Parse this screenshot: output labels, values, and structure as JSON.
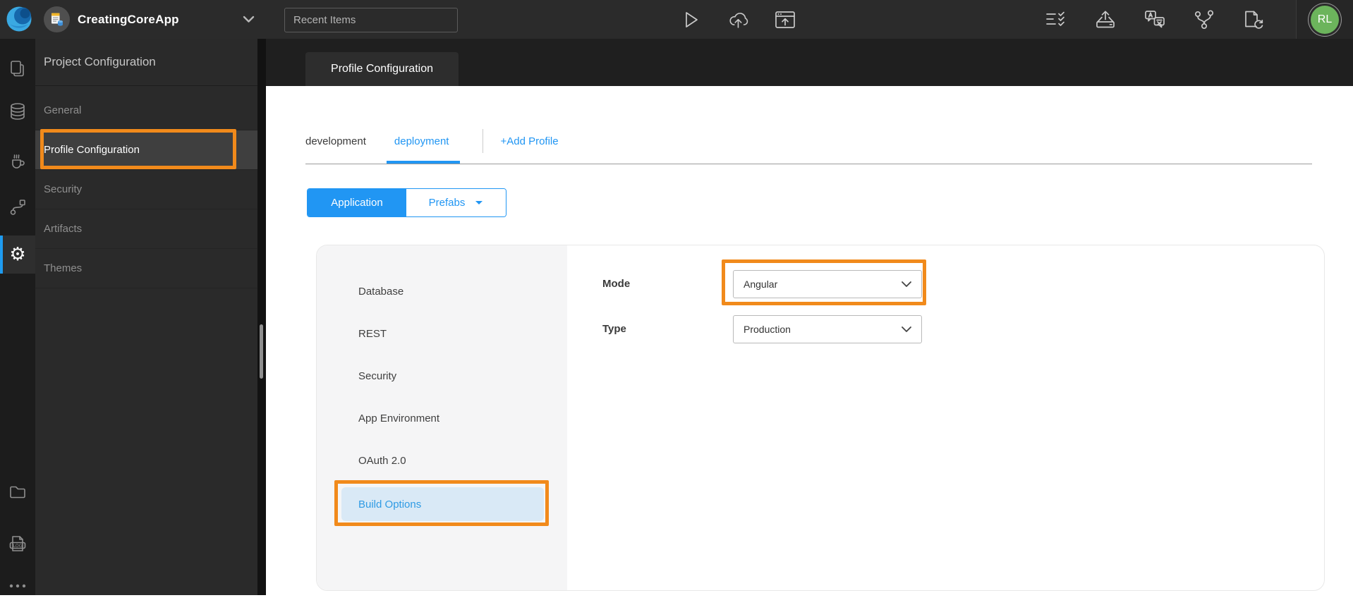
{
  "topbar": {
    "app_name": "CreatingCoreApp",
    "recent_items_placeholder": "Recent Items",
    "avatar_initials": "RL",
    "icons": [
      "play",
      "cloud-upload",
      "app-preview-upload",
      "checklist",
      "deploy-export",
      "translate",
      "version-graph",
      "file-sync"
    ]
  },
  "rail": {
    "icons": [
      "pages",
      "database",
      "java-services",
      "apis",
      "settings-gear",
      "folder",
      "logs",
      "more-dots"
    ],
    "active_icon": "settings-gear"
  },
  "sidebar": {
    "header": "Project Configuration",
    "items": [
      {
        "label": "General",
        "active": false
      },
      {
        "label": "Profile Configuration",
        "active": true,
        "annotated": true
      },
      {
        "label": "Security",
        "active": false
      },
      {
        "label": "Artifacts",
        "active": false
      },
      {
        "label": "Themes",
        "active": false
      }
    ]
  },
  "content": {
    "page_tab": "Profile Configuration",
    "profile_tabs": [
      {
        "label": "development",
        "active": false
      },
      {
        "label": "deployment",
        "active": true
      }
    ],
    "add_profile_label": "+Add Profile",
    "scope_toggle": {
      "application": "Application",
      "prefabs": "Prefabs",
      "selected": "Application"
    },
    "settings_menu": [
      {
        "label": "Database",
        "active": false
      },
      {
        "label": "REST",
        "active": false
      },
      {
        "label": "Security",
        "active": false
      },
      {
        "label": "App Environment",
        "active": false
      },
      {
        "label": "OAuth 2.0",
        "active": false
      },
      {
        "label": "Build Options",
        "active": true,
        "annotated": true
      }
    ],
    "form": {
      "mode_label": "Mode",
      "mode_value": "Angular",
      "type_label": "Type",
      "type_value": "Production"
    }
  },
  "colors": {
    "accent_blue": "#2196F3",
    "annotation_orange": "#F18A1B",
    "avatar_green": "#6CB45C",
    "active_menu_item_bg": "#D9E9F6",
    "topbar_bg": "#2b2b2b",
    "icon_rail_bg": "#1c1c1c"
  }
}
